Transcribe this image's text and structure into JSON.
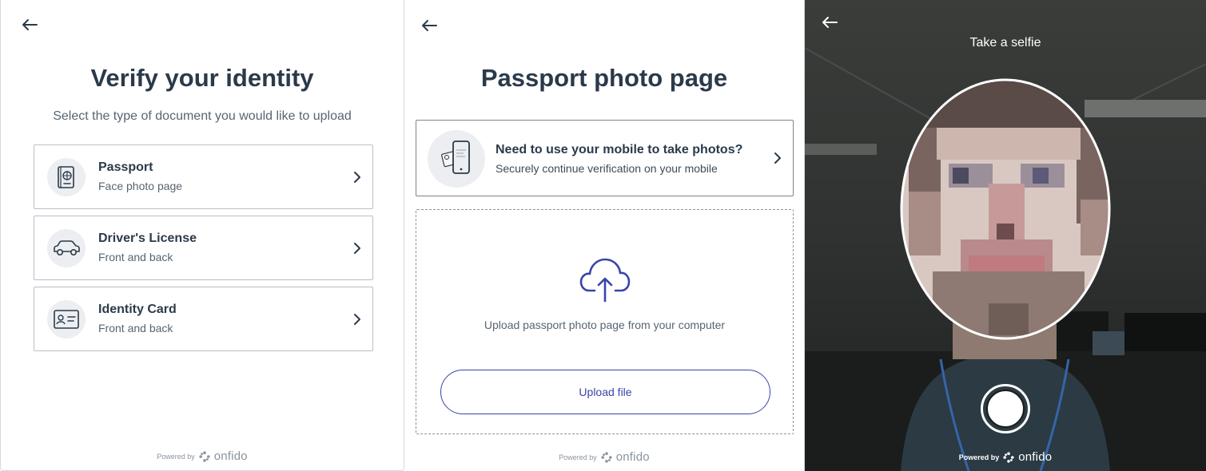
{
  "panel1": {
    "title": "Verify your identity",
    "subtitle": "Select the type of document you would like to upload",
    "documents": [
      {
        "label": "Passport",
        "hint": "Face photo page",
        "icon": "passport-icon"
      },
      {
        "label": "Driver's License",
        "hint": "Front and back",
        "icon": "car-icon"
      },
      {
        "label": "Identity Card",
        "hint": "Front and back",
        "icon": "id-card-icon"
      }
    ],
    "powered_by": "Powered by",
    "brand": "onfido"
  },
  "panel2": {
    "title": "Passport photo page",
    "mobile_title": "Need to use your mobile to take photos?",
    "mobile_hint": "Securely continue verification on your mobile",
    "upload_text": "Upload passport photo page from your computer",
    "upload_button": "Upload file",
    "powered_by": "Powered by",
    "brand": "onfido"
  },
  "panel3": {
    "title": "Take a selfie",
    "powered_by": "Powered by",
    "brand": "onfido"
  },
  "colors": {
    "heading": "#2b3a4a",
    "accent": "#3b43a8",
    "border": "#b9bfc6",
    "icon_bg": "#eceef1"
  }
}
